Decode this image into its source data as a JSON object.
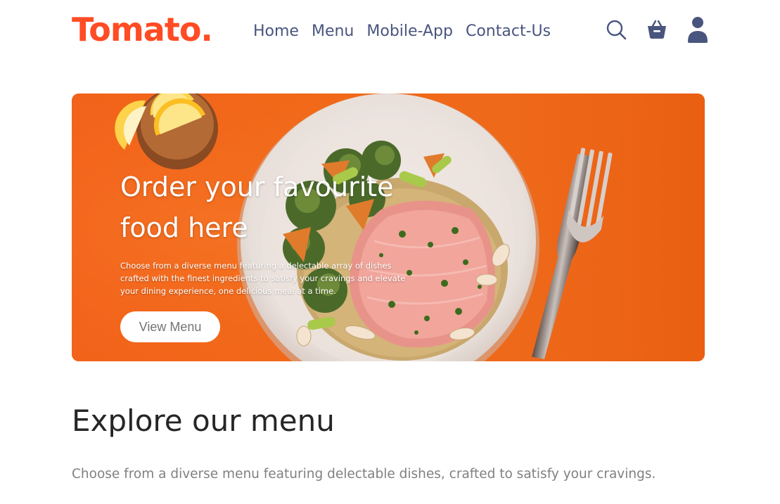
{
  "navbar": {
    "logo": "Tomato.",
    "links": [
      {
        "label": "Home"
      },
      {
        "label": "Menu"
      },
      {
        "label": "Mobile-App"
      },
      {
        "label": "Contact-Us"
      }
    ],
    "icons": [
      "search-icon",
      "basket-icon",
      "user-icon"
    ],
    "accent_color": "#ff4c24",
    "link_color": "#49557e"
  },
  "hero": {
    "title": "Order your favourite food here",
    "description": "Choose from a diverse menu featuring a delectable array of dishes crafted with the finest ingredients to satisfy your cravings and elevate your dining experience, one delicious meal at a time.",
    "button_label": "View Menu",
    "background_color": "#f26a18"
  },
  "explore": {
    "title": "Explore our menu",
    "description": "Choose from a diverse menu featuring delectable dishes, crafted to satisfy your cravings."
  }
}
